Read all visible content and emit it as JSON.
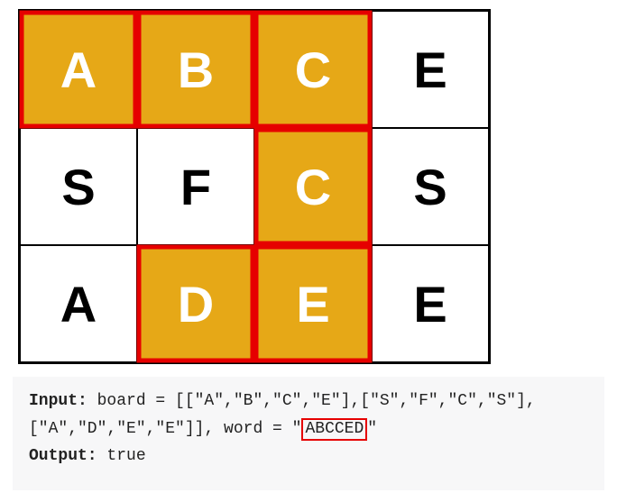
{
  "grid": {
    "rows": [
      [
        {
          "letter": "A",
          "hl": true
        },
        {
          "letter": "B",
          "hl": true
        },
        {
          "letter": "C",
          "hl": true
        },
        {
          "letter": "E",
          "hl": false
        }
      ],
      [
        {
          "letter": "S",
          "hl": false
        },
        {
          "letter": "F",
          "hl": false
        },
        {
          "letter": "C",
          "hl": true
        },
        {
          "letter": "S",
          "hl": false
        }
      ],
      [
        {
          "letter": "A",
          "hl": false
        },
        {
          "letter": "D",
          "hl": true
        },
        {
          "letter": "E",
          "hl": true
        },
        {
          "letter": "E",
          "hl": false
        }
      ]
    ]
  },
  "io": {
    "input_label": "Input:",
    "board_prefix": " board = ",
    "board_line1": "[[\"A\",\"B\",\"C\",\"E\"],[\"S\",\"F\",\"C\",\"S\"],",
    "board_line2": "[\"A\",\"D\",\"E\",\"E\"]]",
    "word_prefix": ", word = ",
    "quote_open": "\"",
    "word_value": "ABCCED",
    "quote_close": "\"",
    "output_label": "Output:",
    "output_value": " true"
  },
  "path": {
    "color": "#e60000",
    "stroke": 5,
    "coords": [
      [
        0,
        0
      ],
      [
        0,
        1
      ],
      [
        0,
        2
      ],
      [
        1,
        2
      ],
      [
        2,
        2
      ],
      [
        2,
        1
      ]
    ],
    "cellSize": 130,
    "offset": 2
  }
}
